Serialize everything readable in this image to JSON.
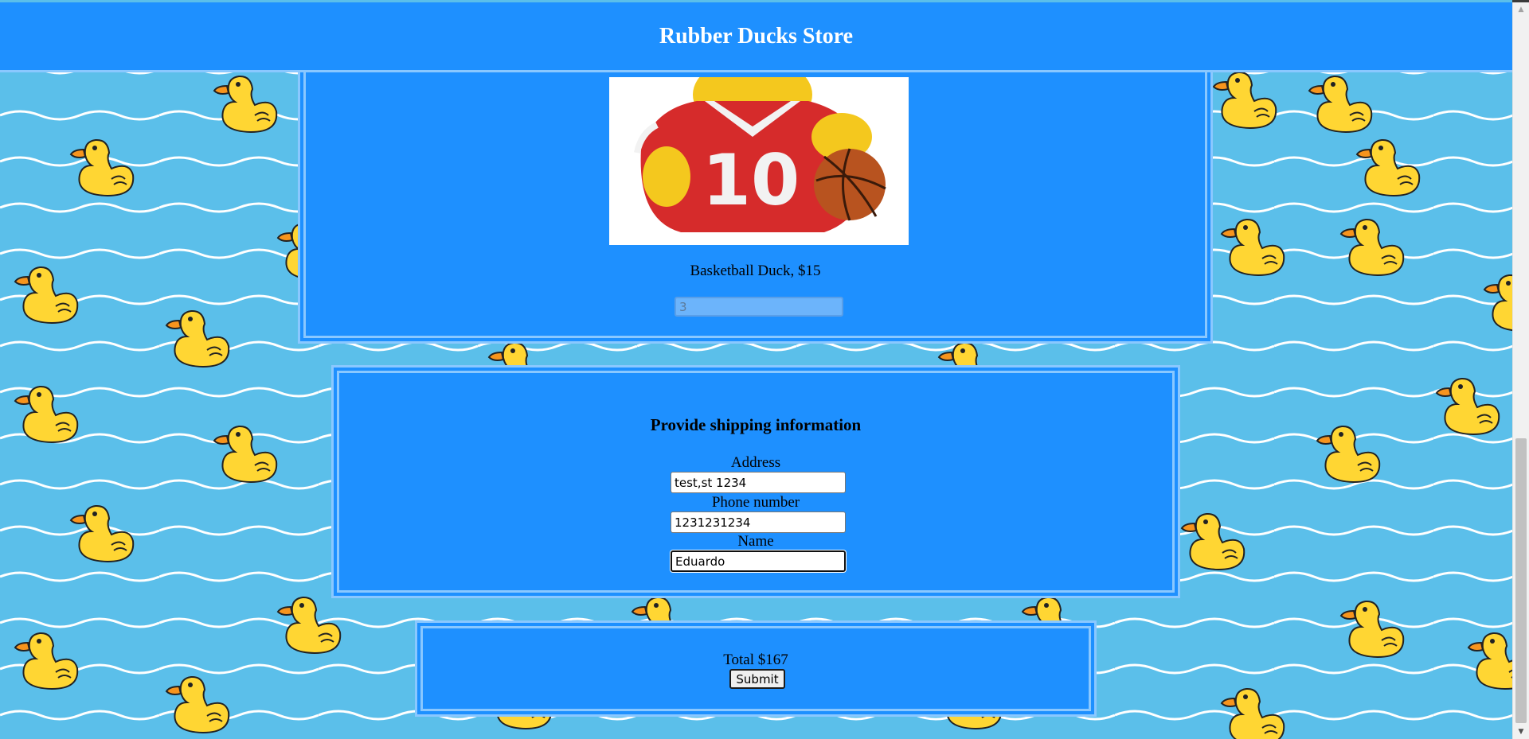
{
  "header": {
    "title": "Rubber Ducks Store"
  },
  "product": {
    "image_alt": "Basketball duck with jersey number 10",
    "jersey_number": "10",
    "name_price": "Basketball Duck, $15",
    "quantity_value": "3"
  },
  "shipping": {
    "heading": "Provide shipping information",
    "address_label": "Address",
    "address_value": "test,st 1234",
    "phone_label": "Phone number",
    "phone_value": "1231231234",
    "name_label": "Name",
    "name_value": "Eduardo"
  },
  "order": {
    "total_text": "Total $167",
    "submit_label": "Submit"
  },
  "scrollbar": {
    "up_arrow": "▲",
    "down_arrow": "▼"
  },
  "colors": {
    "header_bg": "#1e90ff",
    "panel_bg": "#1e90ff",
    "panel_border": "#8ac8ff",
    "page_bg": "#5bbfea",
    "duck_yellow": "#ffd633",
    "duck_beak": "#f7941d"
  }
}
